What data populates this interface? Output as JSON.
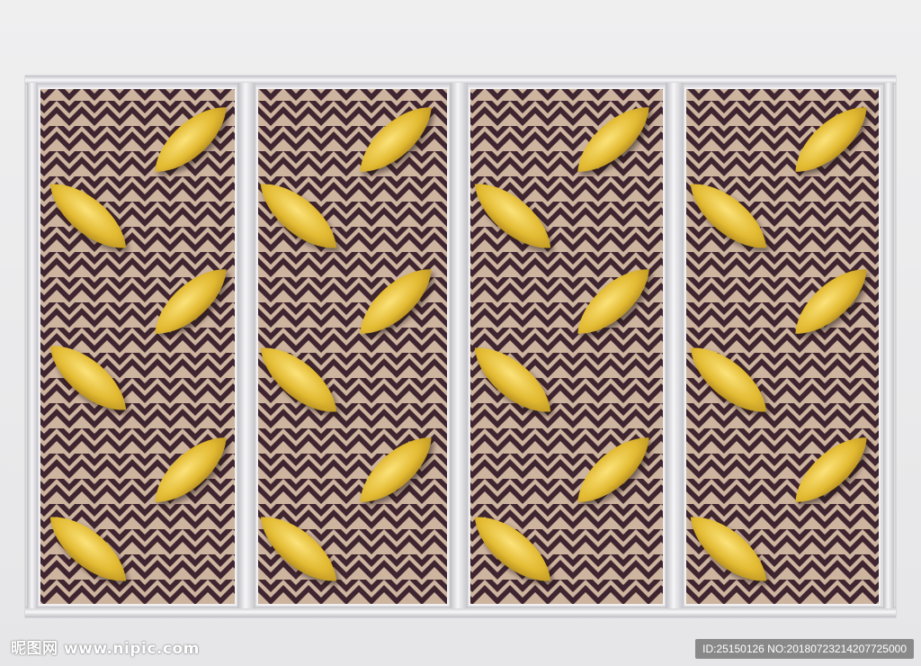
{
  "watermark": {
    "left_text": "昵图网 www.nipic.com",
    "right_text": "ID:25150126 NO:20180723214207725000"
  },
  "colors": {
    "background": "#ececee",
    "rail": "#d8d8dc",
    "chevron_dark": "#3f2530",
    "chevron_light": "#cdb39c",
    "leaf_gold": "#e6bf36"
  }
}
